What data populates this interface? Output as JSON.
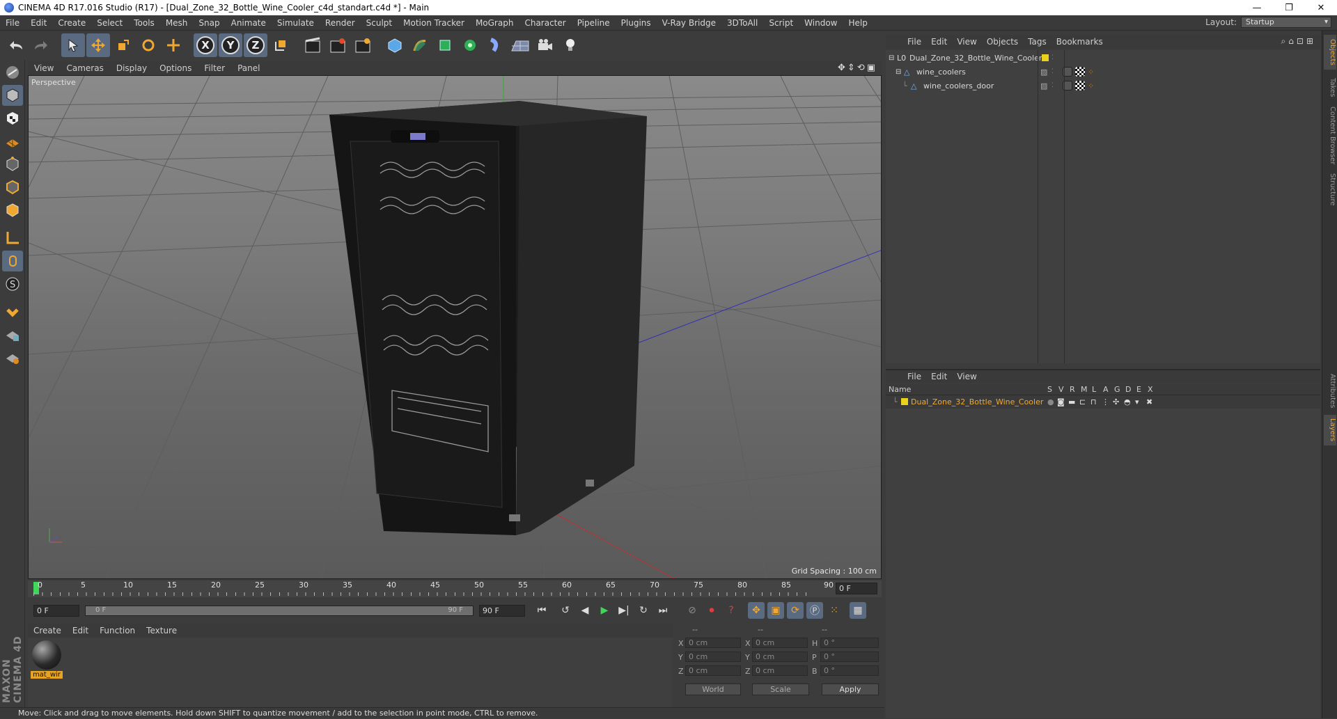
{
  "window": {
    "title": "CINEMA 4D R17.016 Studio (R17) - [Dual_Zone_32_Bottle_Wine_Cooler_c4d_standart.c4d *] - Main",
    "controls": [
      "—",
      "❐",
      "✕"
    ]
  },
  "menubar": {
    "items": [
      "File",
      "Edit",
      "Create",
      "Select",
      "Tools",
      "Mesh",
      "Snap",
      "Animate",
      "Simulate",
      "Render",
      "Sculpt",
      "Motion Tracker",
      "MoGraph",
      "Character",
      "Pipeline",
      "Plugins",
      "V-Ray Bridge",
      "3DToAll",
      "Script",
      "Window",
      "Help"
    ],
    "layout_label": "Layout:",
    "layout_value": "Startup"
  },
  "toolbar": {
    "axis_x": "X",
    "axis_y": "Y",
    "axis_z": "Z"
  },
  "viewport": {
    "menu": [
      "View",
      "Cameras",
      "Display",
      "Options",
      "Filter",
      "Panel"
    ],
    "camera_label": "Perspective",
    "grid_spacing": "Grid Spacing : 100 cm"
  },
  "timeline": {
    "ticks": [
      "0",
      "5",
      "10",
      "15",
      "20",
      "25",
      "30",
      "35",
      "40",
      "45",
      "50",
      "55",
      "60",
      "65",
      "70",
      "75",
      "80",
      "85",
      "90"
    ],
    "current_frame": "0 F",
    "start_field": "0 F",
    "range_start": "0 F",
    "range_end": "90 F",
    "end_field": "90 F"
  },
  "materials": {
    "menu": [
      "Create",
      "Edit",
      "Function",
      "Texture"
    ],
    "items": [
      {
        "name": "mat_wir"
      }
    ]
  },
  "coordinates": {
    "head": [
      "--",
      "--",
      "--"
    ],
    "rows": [
      {
        "a": "X",
        "av": "0 cm",
        "b": "X",
        "bv": "0 cm",
        "c": "H",
        "cv": "0 °"
      },
      {
        "a": "Y",
        "av": "0 cm",
        "b": "Y",
        "bv": "0 cm",
        "c": "P",
        "cv": "0 °"
      },
      {
        "a": "Z",
        "av": "0 cm",
        "b": "Z",
        "bv": "0 cm",
        "c": "B",
        "cv": "0 °"
      }
    ],
    "world": "World",
    "scale": "Scale",
    "apply": "Apply"
  },
  "status": {
    "text": "Move: Click and drag to move elements. Hold down SHIFT to quantize movement / add to the selection in point mode, CTRL to remove."
  },
  "object_manager": {
    "menu": [
      "File",
      "Edit",
      "View",
      "Objects",
      "Tags",
      "Bookmarks"
    ],
    "objects": [
      {
        "name": "Dual_Zone_32_Bottle_Wine_Cooler",
        "layer_color": "#e8d21c"
      },
      {
        "name": "wine_coolers"
      },
      {
        "name": "wine_coolers_door"
      }
    ]
  },
  "layer_manager": {
    "menu": [
      "File",
      "Edit",
      "View"
    ],
    "columns": [
      "Name",
      "S",
      "V",
      "R",
      "M",
      "L",
      "A",
      "G",
      "D",
      "E",
      "X"
    ],
    "layers": [
      {
        "name": "Dual_Zone_32_Bottle_Wine_Cooler",
        "color": "#e8d21c"
      }
    ]
  },
  "side_tabs": [
    "Objects",
    "Takes",
    "Content Browser",
    "Structure",
    "Attributes",
    "Layers"
  ],
  "brand": "MAXON CINEMA 4D",
  "colors": {
    "accent": "#f0a830",
    "active_tool": "#5a6a80",
    "play": "#3fd65a",
    "record": "#e23b3b"
  }
}
